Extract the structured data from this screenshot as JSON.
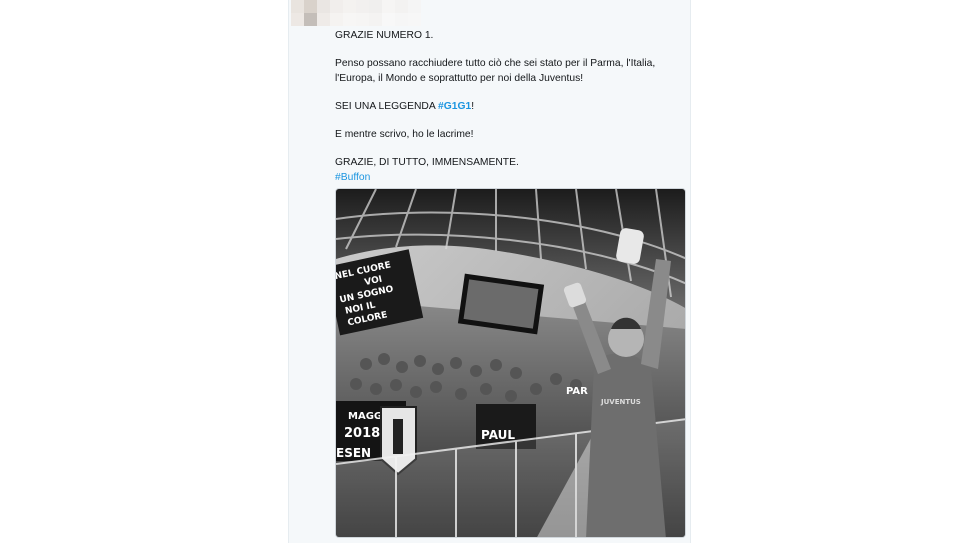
{
  "tweet": {
    "line1": "GRAZIE NUMERO 1.",
    "line2": "Penso possano racchiudere tutto ciò che sei stato per il Parma, l'Italia, l'Europa, il Mondo e soprattutto per noi della Juventus!",
    "line3_prefix": "SEI UNA LEGGENDA ",
    "line3_hashtag": "#G1G1",
    "line3_suffix": "!",
    "line4": "E mentre scrivo, ho le lacrime!",
    "line5": "GRAZIE, DI TUTTO, IMMENSAMENTE.",
    "line6_hashtag": "#Buffon"
  },
  "photo": {
    "banner_text_1": "NEL CUORE",
    "banner_text_2": "VOI",
    "banner_text_3": "UN SOGNO",
    "banner_text_4": "NOI IL",
    "banner_text_5": "COLORE",
    "banner_date_1": "MAGGIO",
    "banner_date_2": "2018",
    "banner_side": "ESEN",
    "banner_right": "PAUL",
    "crest_text": "JUVENTUS",
    "flag_letters": "PAR"
  },
  "colors": {
    "hashtag": "#1b95e0",
    "card_bg": "#f5f8fa",
    "text": "#14171a"
  }
}
